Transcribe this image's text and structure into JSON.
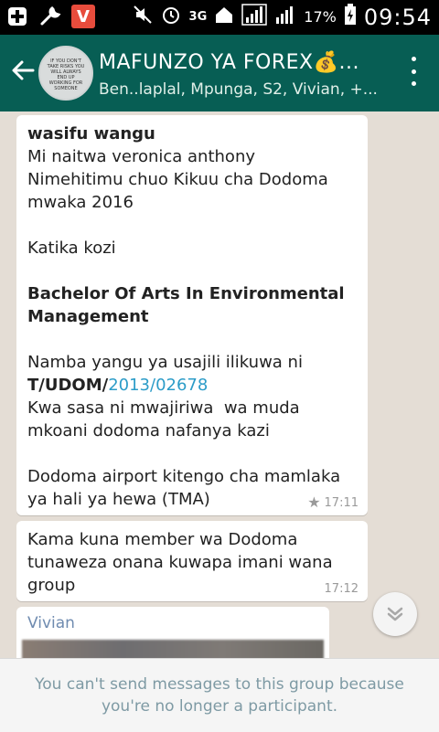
{
  "status_bar": {
    "network": "3G",
    "battery": "17%",
    "time": "09:54"
  },
  "header": {
    "title": "MAFUNZO YA FOREX💰...",
    "subtitle": "Ben..laplal, Mpunga, S2, Vivian, +...",
    "avatar_text": "IF YOU DON'T TAKE RISKS YOU WILL ALWAYS END UP WORKING FOR SOMEONE"
  },
  "messages": [
    {
      "line_1": "wasifu wangu",
      "line_2": "Mi naitwa veronica anthony",
      "line_3": "Nimehitimu chuo Kikuu cha Dodoma\nmwaka 2016\n\nKatika kozi\n",
      "line_4": "Bachelor Of Arts In Environmental\nManagement",
      "line_5": "\nNamba yangu ya usajili ilikuwa ni\n",
      "reg_prefix": "T/UDOM/",
      "reg_link": "2013/02678",
      "line_6": "\nKwa sasa ni mwajiriwa  wa muda\nmkoani dodoma nafanya kazi\n\nDodoma airport kitengo cha mamlaka\nya hali ya hewa (TMA)",
      "time": "17:11"
    },
    {
      "text": "Kama kuna member wa Dodoma\ntunaweza onana kuwapa imani wana\ngroup",
      "time": "17:12"
    },
    {
      "sender": "Vivian"
    }
  ],
  "footer": {
    "notice": "You can't send messages to this group because you're no longer a participant."
  },
  "colors": {
    "toolbar": "#075e54",
    "chat_bg": "#e4ddd5",
    "link": "#2c9cc8",
    "sender_name": "#6f8bb0"
  }
}
